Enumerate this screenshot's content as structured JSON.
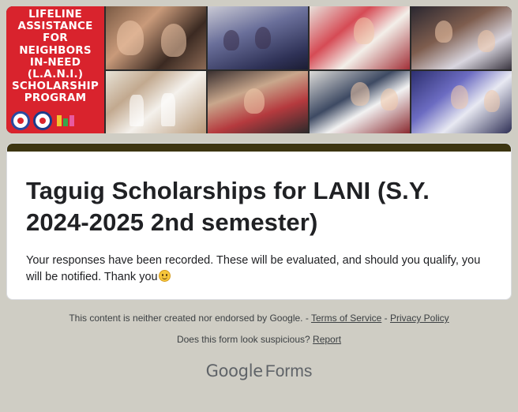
{
  "banner": {
    "title_text": "LIFELINE\nASSISTANCE\nFOR\nNEIGHBORS\nIN-NEED\n(L.A.N.I.)\nSCHOLARSHIP\nPROGRAM",
    "colors": {
      "red": "#d9232d",
      "white": "#ffffff"
    }
  },
  "form": {
    "accent_color": "#3d3511",
    "title": "Taguig Scholarships for LANI (S.Y. 2024-2025 2nd semester)",
    "confirmation_message": "Your responses have been recorded. These will be evaluated, and should you qualify, you will be notified. Thank you",
    "emoji": "slightly-smiling-face"
  },
  "footer": {
    "disclaimer": "This content is neither created nor endorsed by Google.",
    "separator": " - ",
    "terms_link": "Terms of Service",
    "privacy_link": "Privacy Policy",
    "suspicious_text": "Does this form look suspicious?",
    "report_link": "Report"
  },
  "branding": {
    "google": "Google",
    "forms": "Forms"
  }
}
